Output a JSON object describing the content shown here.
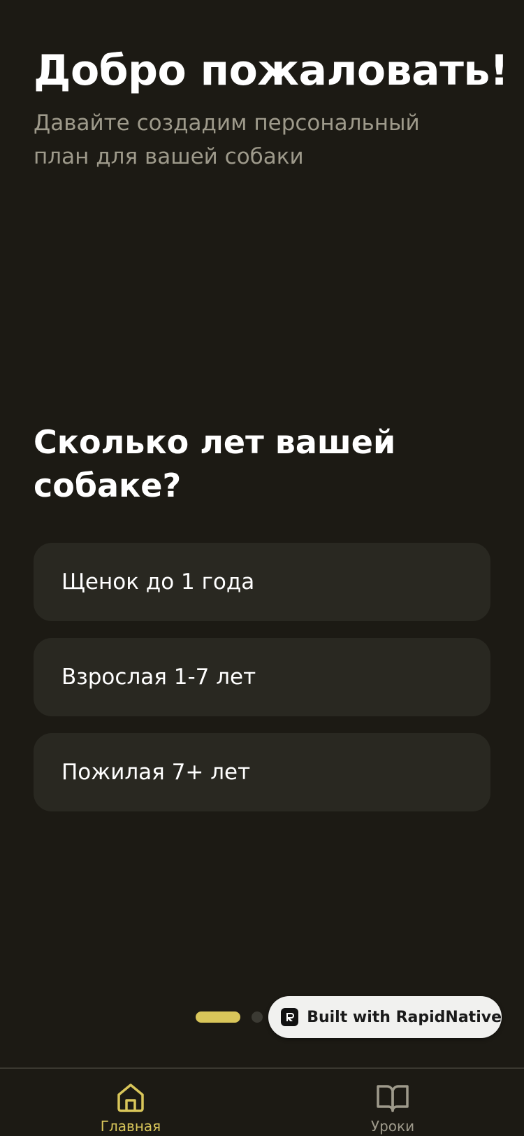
{
  "header": {
    "title": "Добро пожаловать!",
    "subtitle": "Давайте создадим персональный план для вашей собаки"
  },
  "question": {
    "text": "Сколько лет вашей собаке?",
    "options": [
      {
        "label": "Щенок до 1 года"
      },
      {
        "label": "Взрослая 1-7 лет"
      },
      {
        "label": "Пожилая 7+ лет"
      }
    ]
  },
  "pager": {
    "total": 2,
    "active_index": 0
  },
  "badge": {
    "text": "Built with RapidNative",
    "icon": "rapidnative-logo-icon"
  },
  "tabbar": {
    "tabs": [
      {
        "label": "Главная",
        "icon": "home-icon",
        "active": true
      },
      {
        "label": "Уроки",
        "icon": "book-icon",
        "active": false
      }
    ]
  },
  "colors": {
    "background": "#1c1a14",
    "card": "#292821",
    "accent": "#d9c65a",
    "muted_text": "#9e9a8b",
    "badge_bg": "#f1f1ef"
  }
}
